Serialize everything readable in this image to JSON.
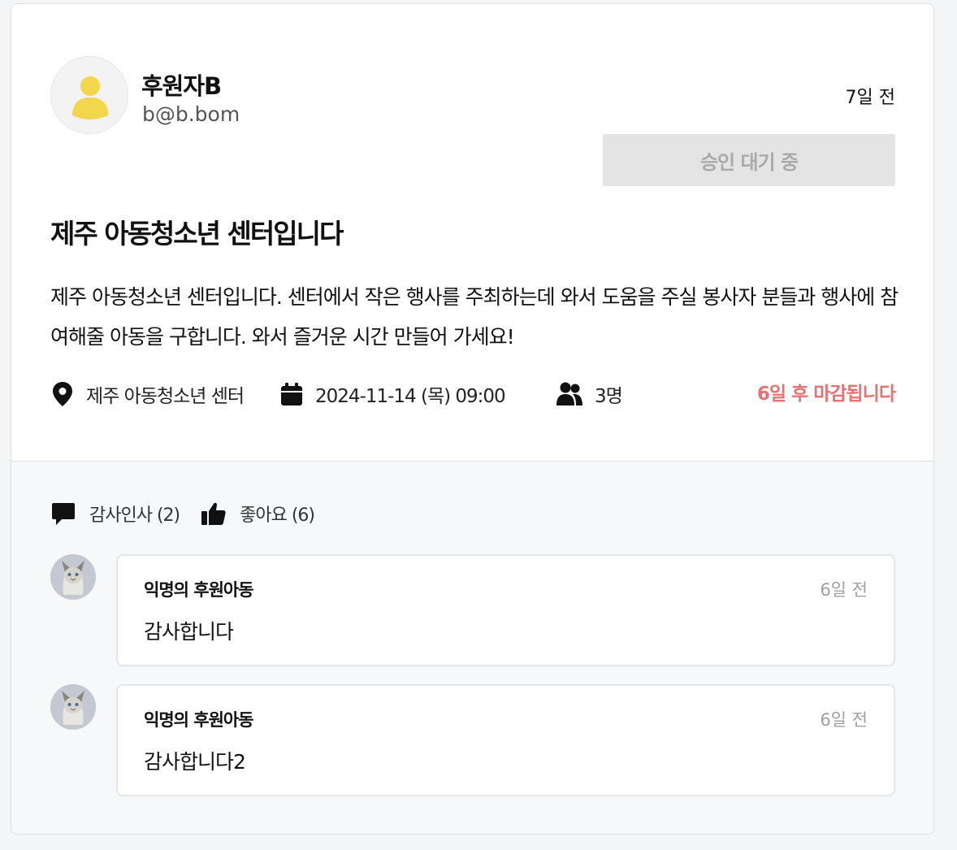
{
  "author": {
    "name": "후원자B",
    "email": "b@b.bom"
  },
  "post": {
    "time_ago": "7일 전",
    "status_label": "승인 대기 중",
    "title": "제주 아동청소년 센터입니다",
    "body": "제주 아동청소년 센터입니다. 센터에서 작은 행사를 주최하는데 와서 도움을 주실 봉사자 분들과 행사에 참여해줄 아동을 구합니다. 와서 즐거운 시간 만들어 가세요!",
    "location": "제주 아동청소년 센터",
    "datetime": "2024-11-14 (목) 09:00",
    "people": "3명",
    "deadline": "6일 후 마감됩니다"
  },
  "reactions": {
    "thanks_label": "감사인사 (2)",
    "like_label": "좋아요 (6)"
  },
  "comments": [
    {
      "author": "익명의 후원아동",
      "time": "6일 전",
      "text": "감사합니다"
    },
    {
      "author": "익명의 후원아동",
      "time": "6일 전",
      "text": "감사합니다2"
    }
  ],
  "colors": {
    "avatar_icon": "#f2d64b",
    "deadline": "#e57373",
    "status_bg": "#e4e4e4",
    "status_text": "#a9a9a9",
    "bottom_bg": "#f7f8fa"
  },
  "icons": {
    "location": "location-pin-icon",
    "calendar": "calendar-icon",
    "people": "people-icon",
    "comment": "comment-icon",
    "like": "thumbs-up-icon",
    "author_avatar": "user-icon",
    "comment_avatar": "cat-photo-avatar"
  }
}
